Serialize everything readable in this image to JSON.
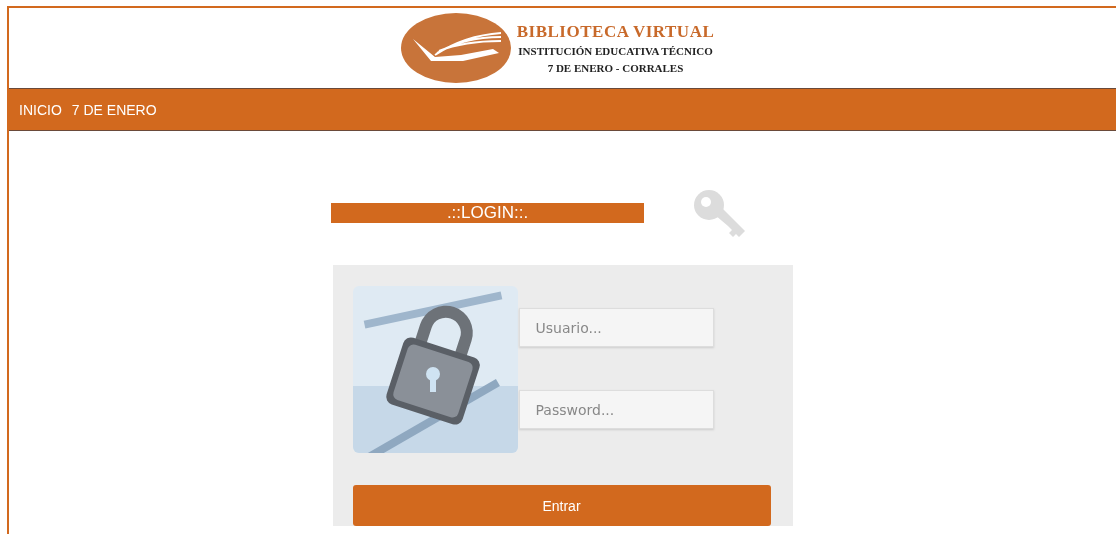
{
  "header": {
    "title": "BIBLIOTECA VIRTUAL",
    "subtitle": "INSTITUCIÓN EDUCATIVA TÉCNICO",
    "location": "7 DE ENERO - CORRALES"
  },
  "nav": {
    "items": [
      {
        "label": "INICIO"
      },
      {
        "label": "7 DE ENERO"
      }
    ]
  },
  "login": {
    "title": ".::LOGIN::.",
    "fields": [
      {
        "placeholder": "Usuario..."
      },
      {
        "placeholder": "Password..."
      }
    ],
    "submit": "Entrar"
  }
}
